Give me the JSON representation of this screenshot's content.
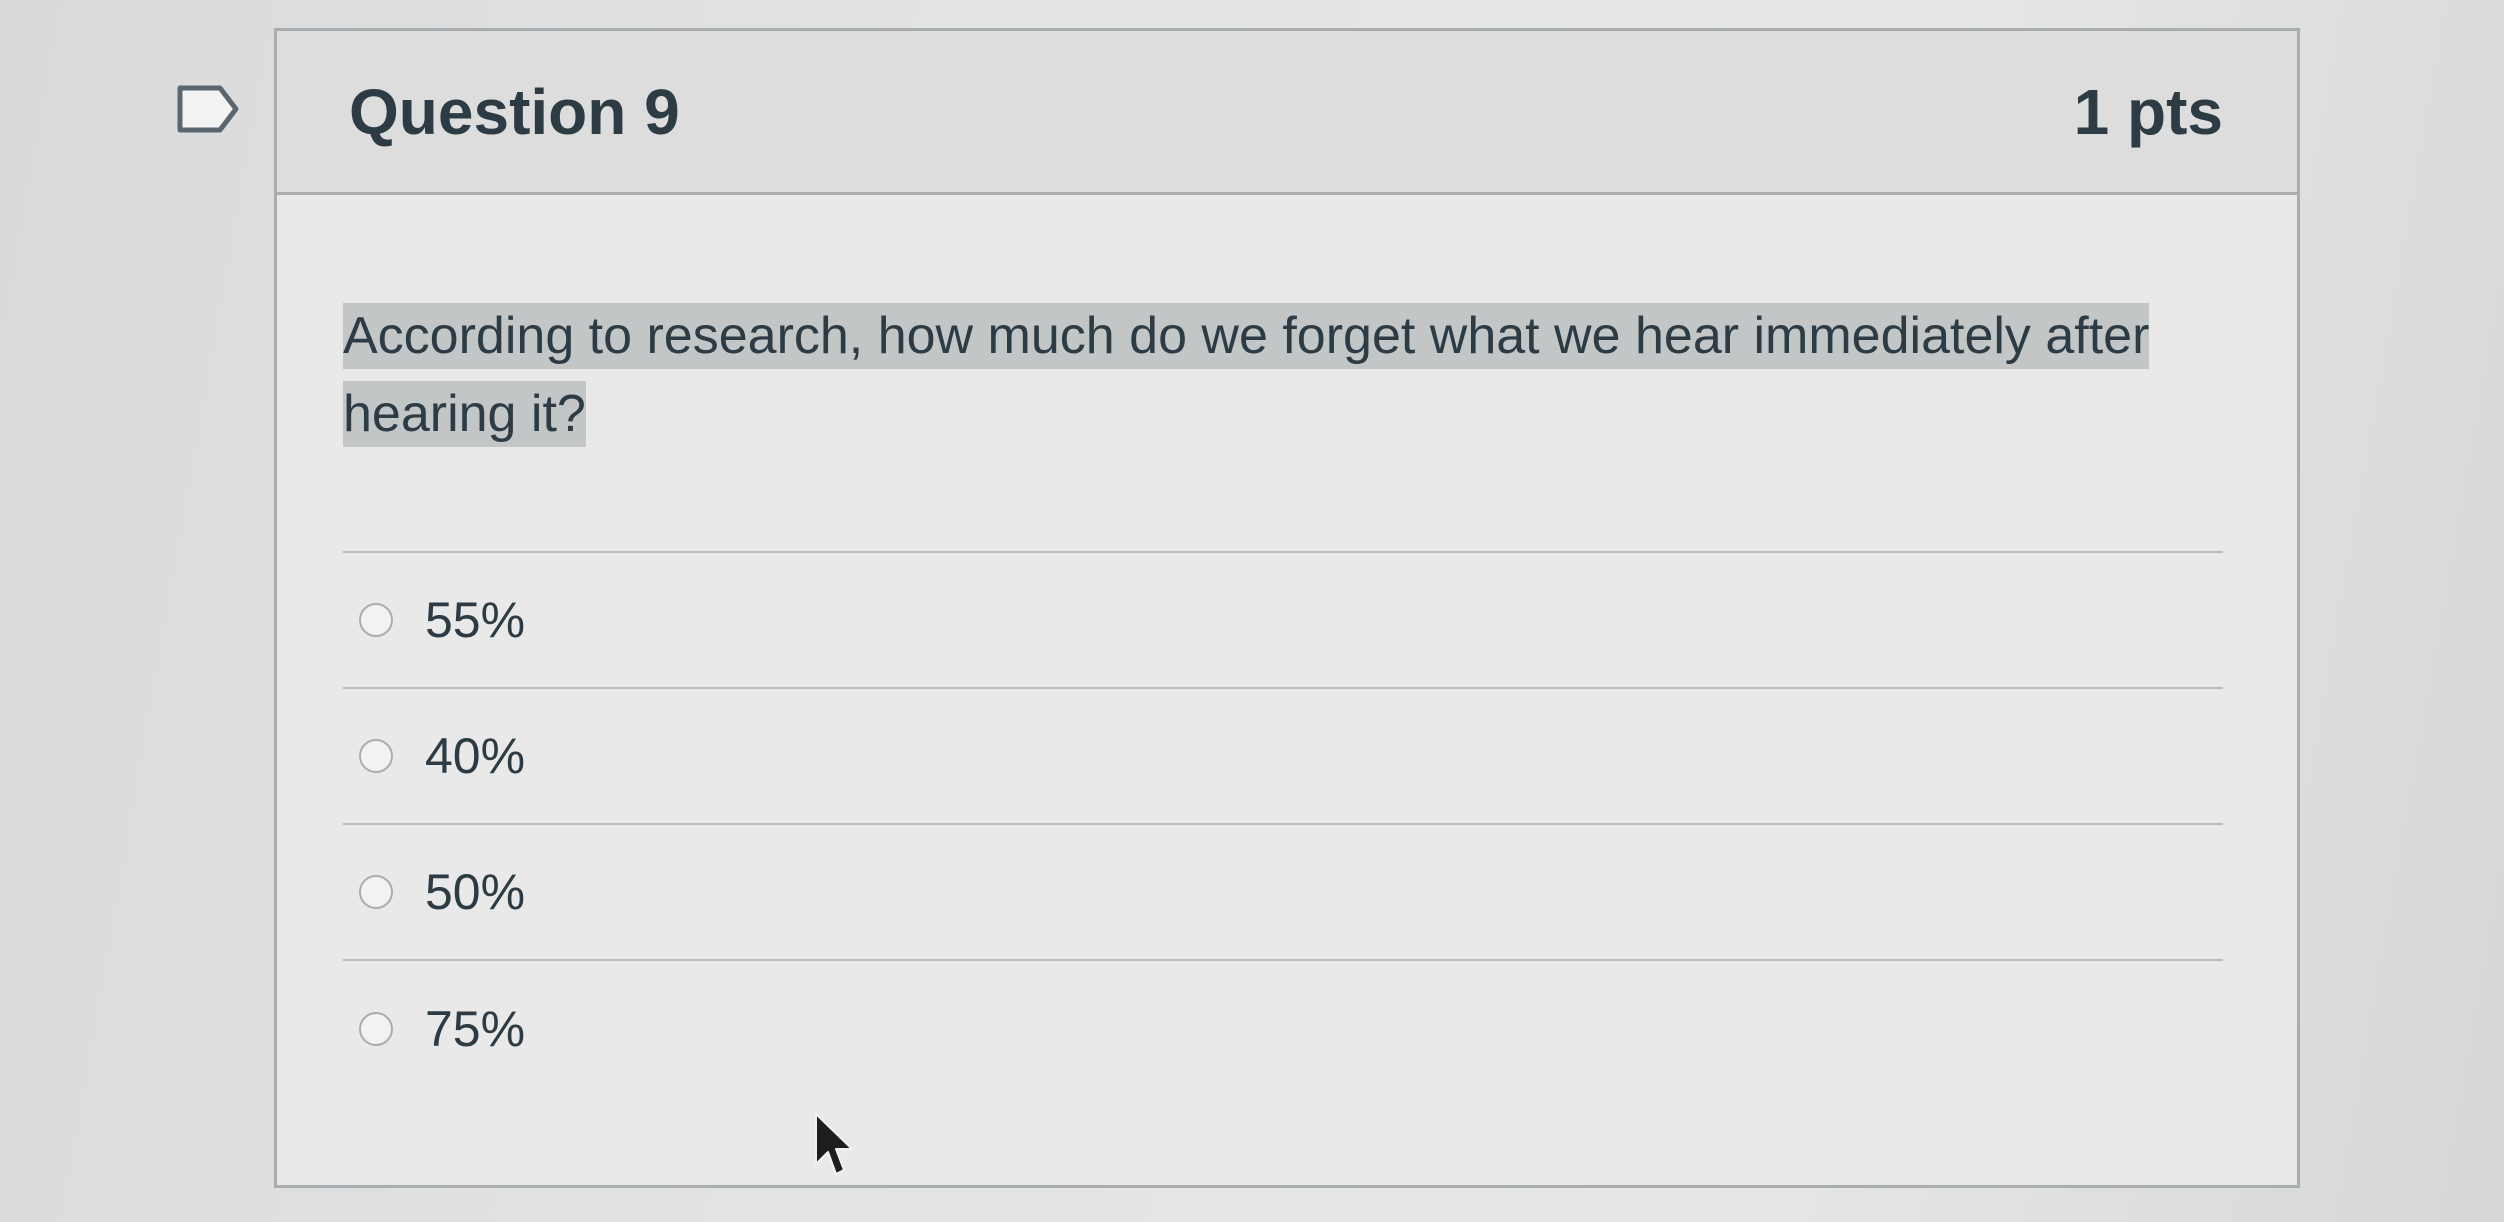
{
  "question": {
    "title": "Question 9",
    "points": "1 pts",
    "text": "According to research, how much do we forget what we hear immediately after hearing it?",
    "flag_icon": "flag-outline-icon"
  },
  "answers": [
    {
      "label": "55%"
    },
    {
      "label": "40%"
    },
    {
      "label": "50%"
    },
    {
      "label": "75%"
    }
  ],
  "colors": {
    "text": "#2d3b45",
    "border": "#a9adb0",
    "header_bg": "#dcdddc",
    "highlight": "#c3c6c6"
  }
}
